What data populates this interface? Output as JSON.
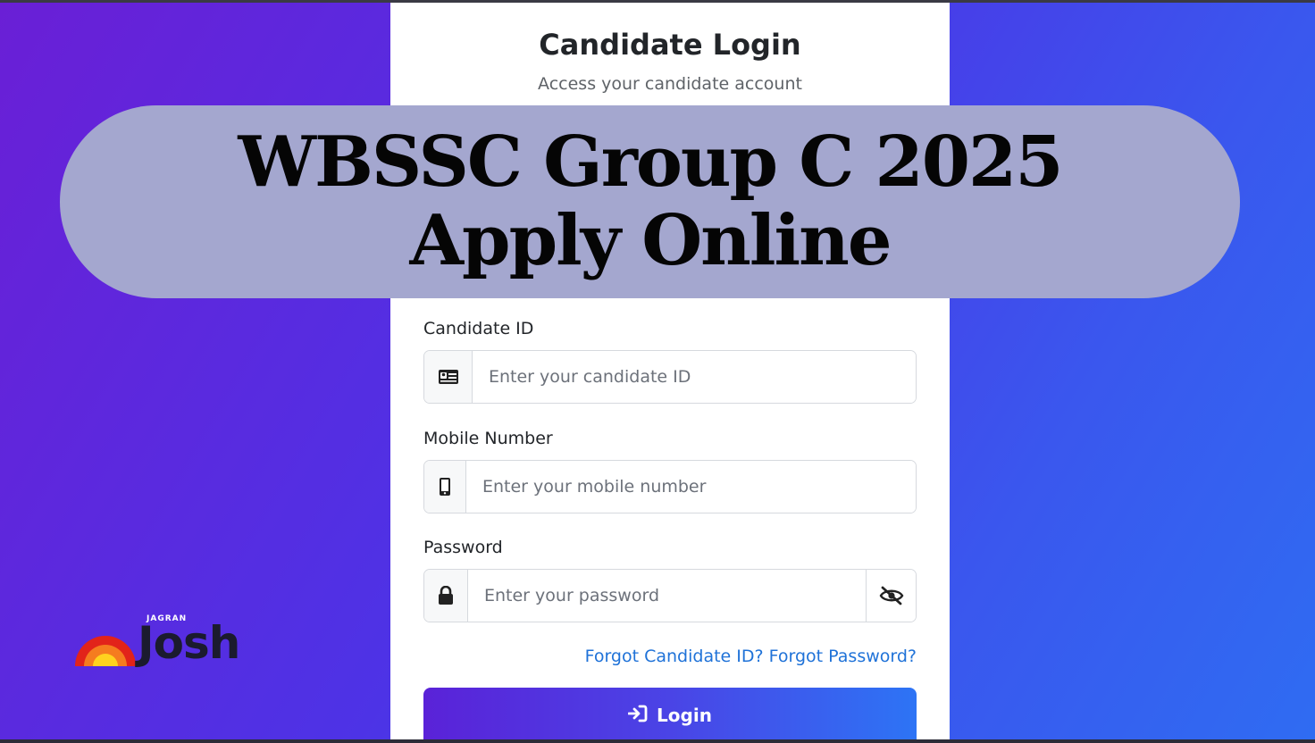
{
  "login_card": {
    "title": "Candidate Login",
    "subtitle": "Access your candidate account"
  },
  "banner": {
    "text": "WBSSC Group C 2025 Apply Online"
  },
  "form": {
    "candidate_id": {
      "label": "Candidate ID",
      "placeholder": "Enter your candidate ID",
      "icon": "id-card-icon"
    },
    "mobile": {
      "label": "Mobile Number",
      "placeholder": "Enter your mobile number",
      "icon": "mobile-phone-icon"
    },
    "password": {
      "label": "Password",
      "placeholder": "Enter your password",
      "icon": "lock-icon",
      "toggle_icon": "eye-slash-icon"
    },
    "forgot_id": "Forgot Candidate ID?",
    "forgot_password": "Forgot Password?",
    "login_label": "Login",
    "login_icon": "sign-in-icon"
  },
  "logo": {
    "small_text": "JAGRAN",
    "word": "Josh"
  },
  "colors": {
    "link": "#1f72d8",
    "banner_bg": "#a4a7cf",
    "button_start": "#5a22d8",
    "button_end": "#2d74f5"
  }
}
